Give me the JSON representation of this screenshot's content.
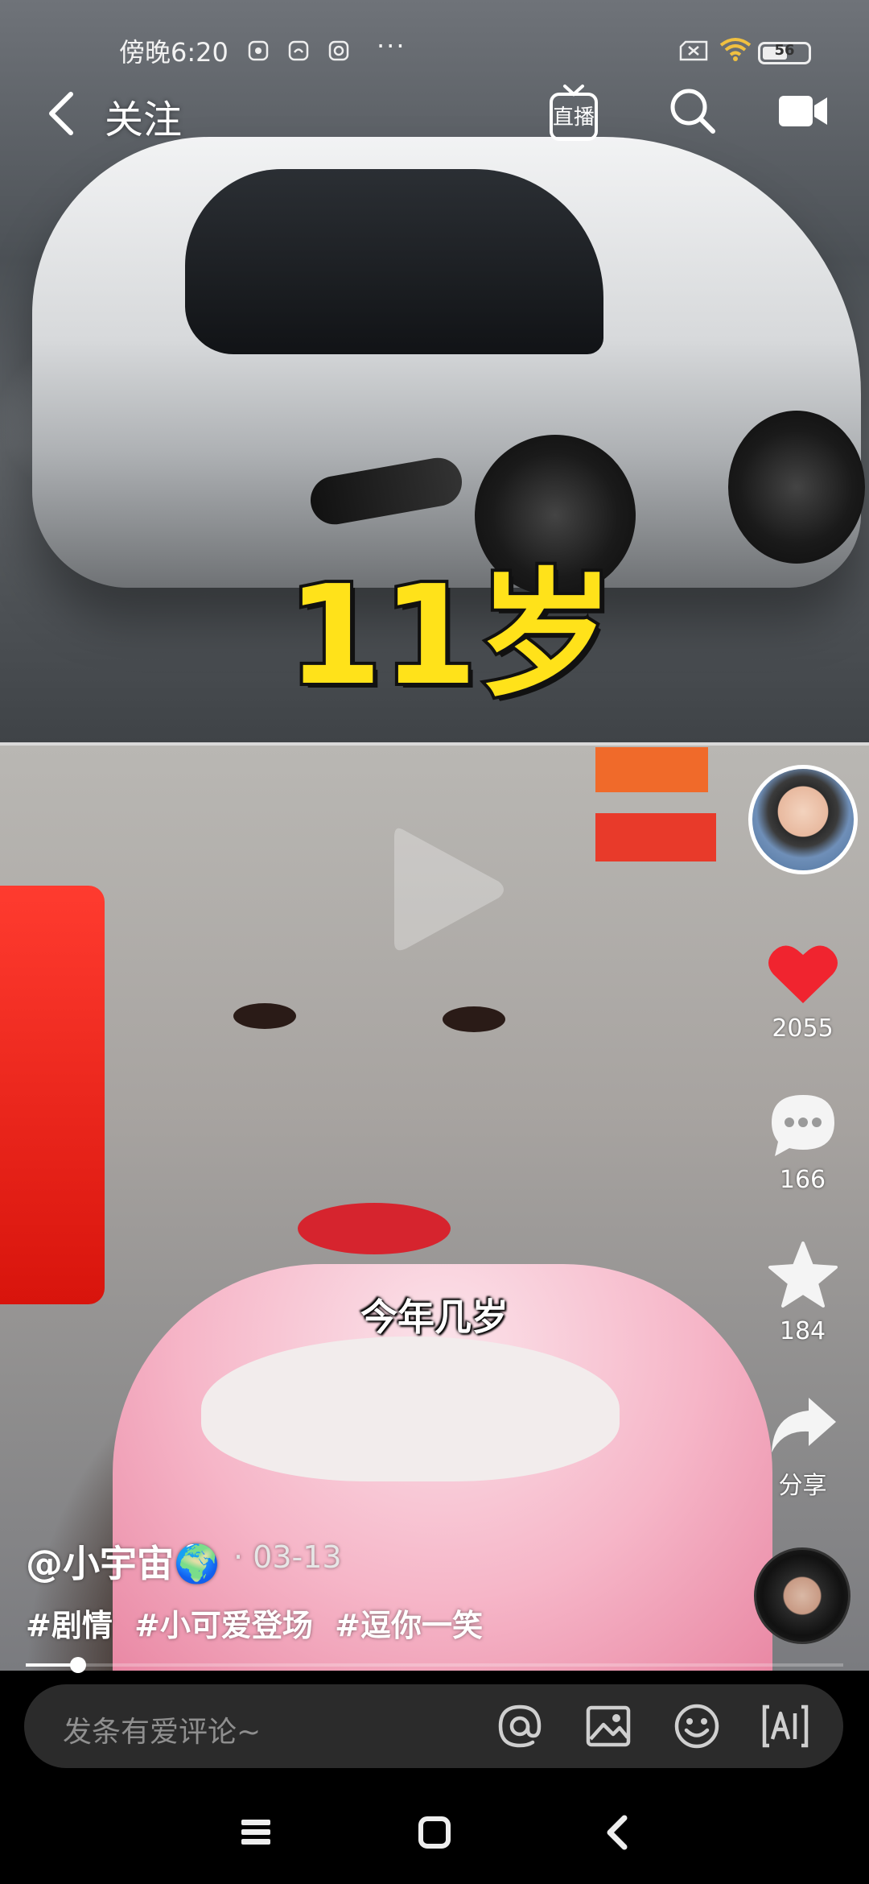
{
  "status_bar": {
    "time": "傍晚6:20",
    "more": "···",
    "battery": "56",
    "battery_level": 0.56
  },
  "top_nav": {
    "follow_label": "关注",
    "live_label": "直播"
  },
  "video": {
    "overlay_text": "11岁",
    "subtitle": "今年几岁",
    "progress": 0.064
  },
  "actions": {
    "like_count": "2055",
    "comment_count": "166",
    "favorite_count": "184",
    "share_label": "分享"
  },
  "post": {
    "author": "@小宇宙🌍",
    "date": "· 03-13",
    "hashtags": [
      "#剧情",
      "#小可爱登场",
      "#逗你一笑"
    ]
  },
  "comment_bar": {
    "placeholder": "发条有爱评论~"
  },
  "colors": {
    "like": "#f0242f",
    "overlay_yellow": "#ffe21a",
    "comment_bar_bg": "#2b2b2b"
  },
  "icons": [
    "back-arrow-icon",
    "live-icon",
    "search-icon",
    "camera-icon",
    "heart-icon",
    "comment-icon",
    "star-icon",
    "share-icon",
    "at-icon",
    "image-icon",
    "emoji-icon",
    "ai-icon",
    "menu-icon",
    "home-icon",
    "back-icon"
  ]
}
